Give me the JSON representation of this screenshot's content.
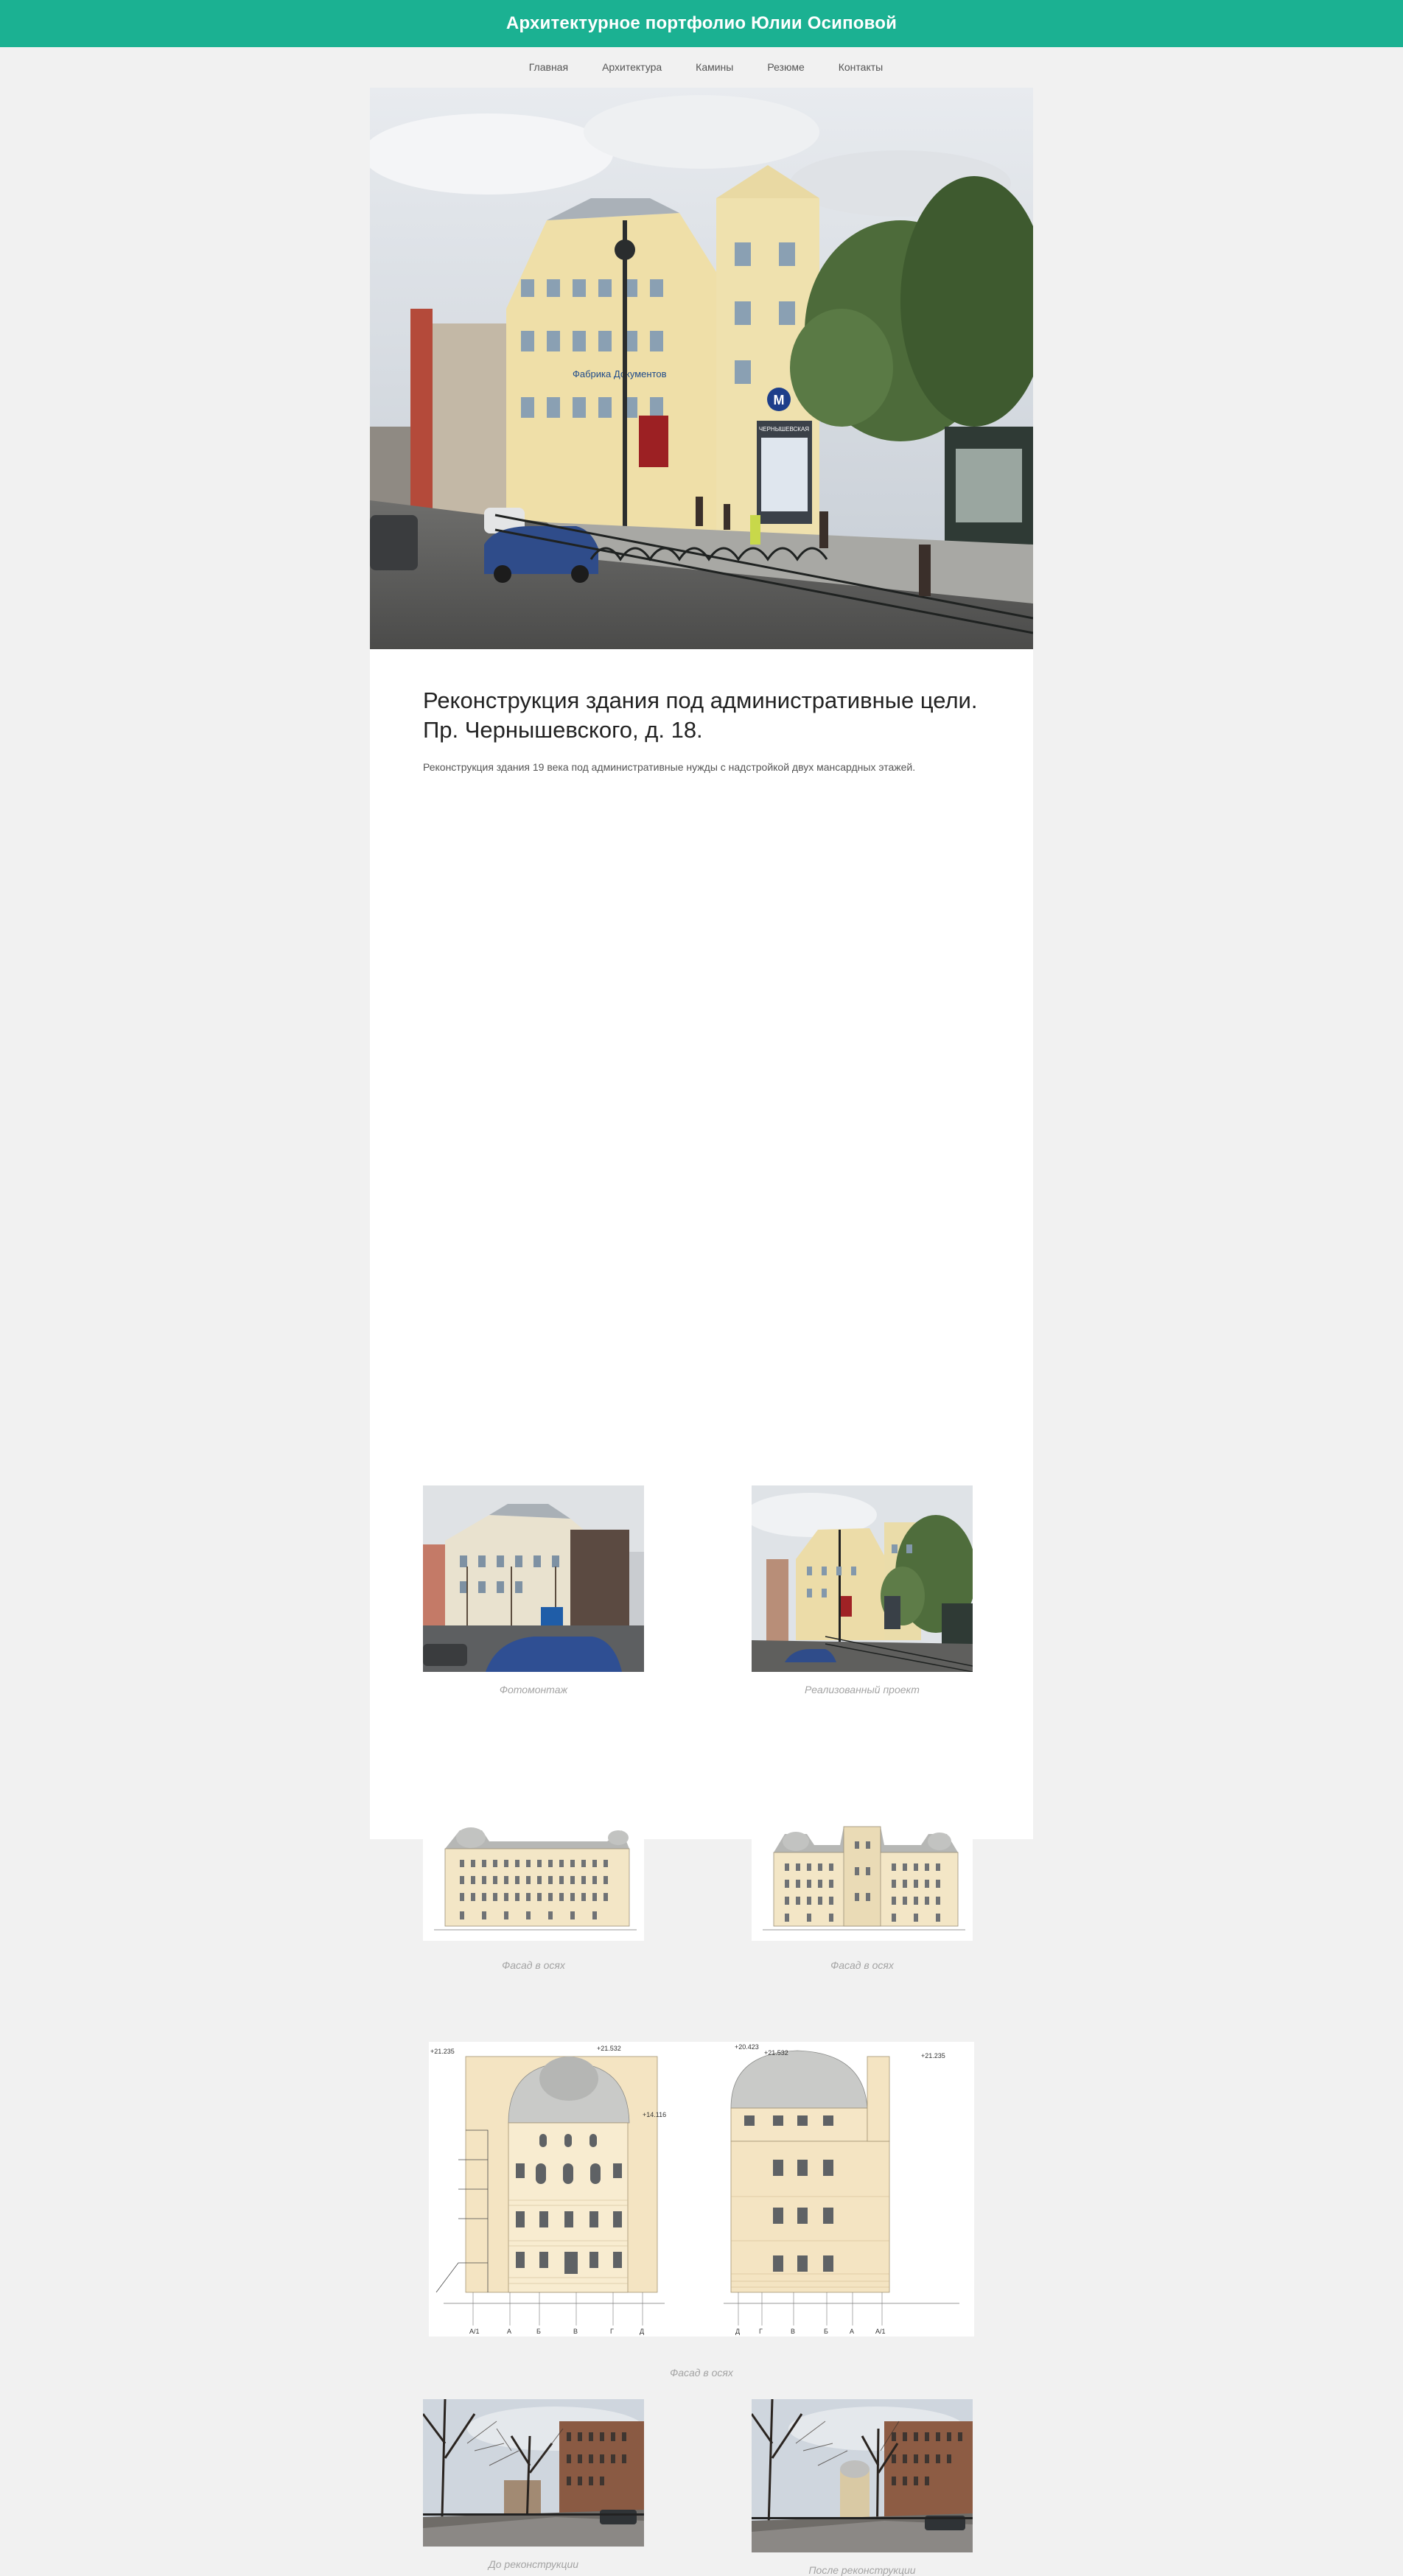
{
  "header": {
    "site_title": "Архитектурное портфолио Юлии Осиповой"
  },
  "nav": {
    "items": [
      "Главная",
      "Архитектура",
      "Камины",
      "Резюме",
      "Контакты"
    ]
  },
  "hero": {
    "signs": {
      "metro": "M",
      "station": "ЧЕРНЫШЕВСКАЯ",
      "shop": "Фабрика Документов"
    }
  },
  "post": {
    "title": "Реконструкция здания под административные цели. Пр. Чернышевского, д. 18.",
    "description": "Реконструкция здания 19 века под административные нужды с надстройкой двух мансардных этажей."
  },
  "gallery": {
    "captions": {
      "photomontage": "Фотомонтаж",
      "realized": "Реализованный проект",
      "facade_1": "Фасад в осях",
      "facade_2": "Фасад в осях",
      "facade_3": "Фасад в осях",
      "before": "До реконструкции",
      "after": "После реконструкции"
    },
    "drawing_labels": {
      "elev_left_top": "+21.235",
      "elev_left_mid": "+21.532",
      "elev_left_side": "+14.116",
      "elev_right_top": "+20.423",
      "elev_right_mid": "+21.532",
      "elev_right_side": "+21.235",
      "axes_left": [
        "А/1",
        "А",
        "Б",
        "В",
        "Г",
        "Д"
      ],
      "axes_right": [
        "Д",
        "Г",
        "В",
        "Б",
        "А",
        "А/1"
      ]
    }
  }
}
